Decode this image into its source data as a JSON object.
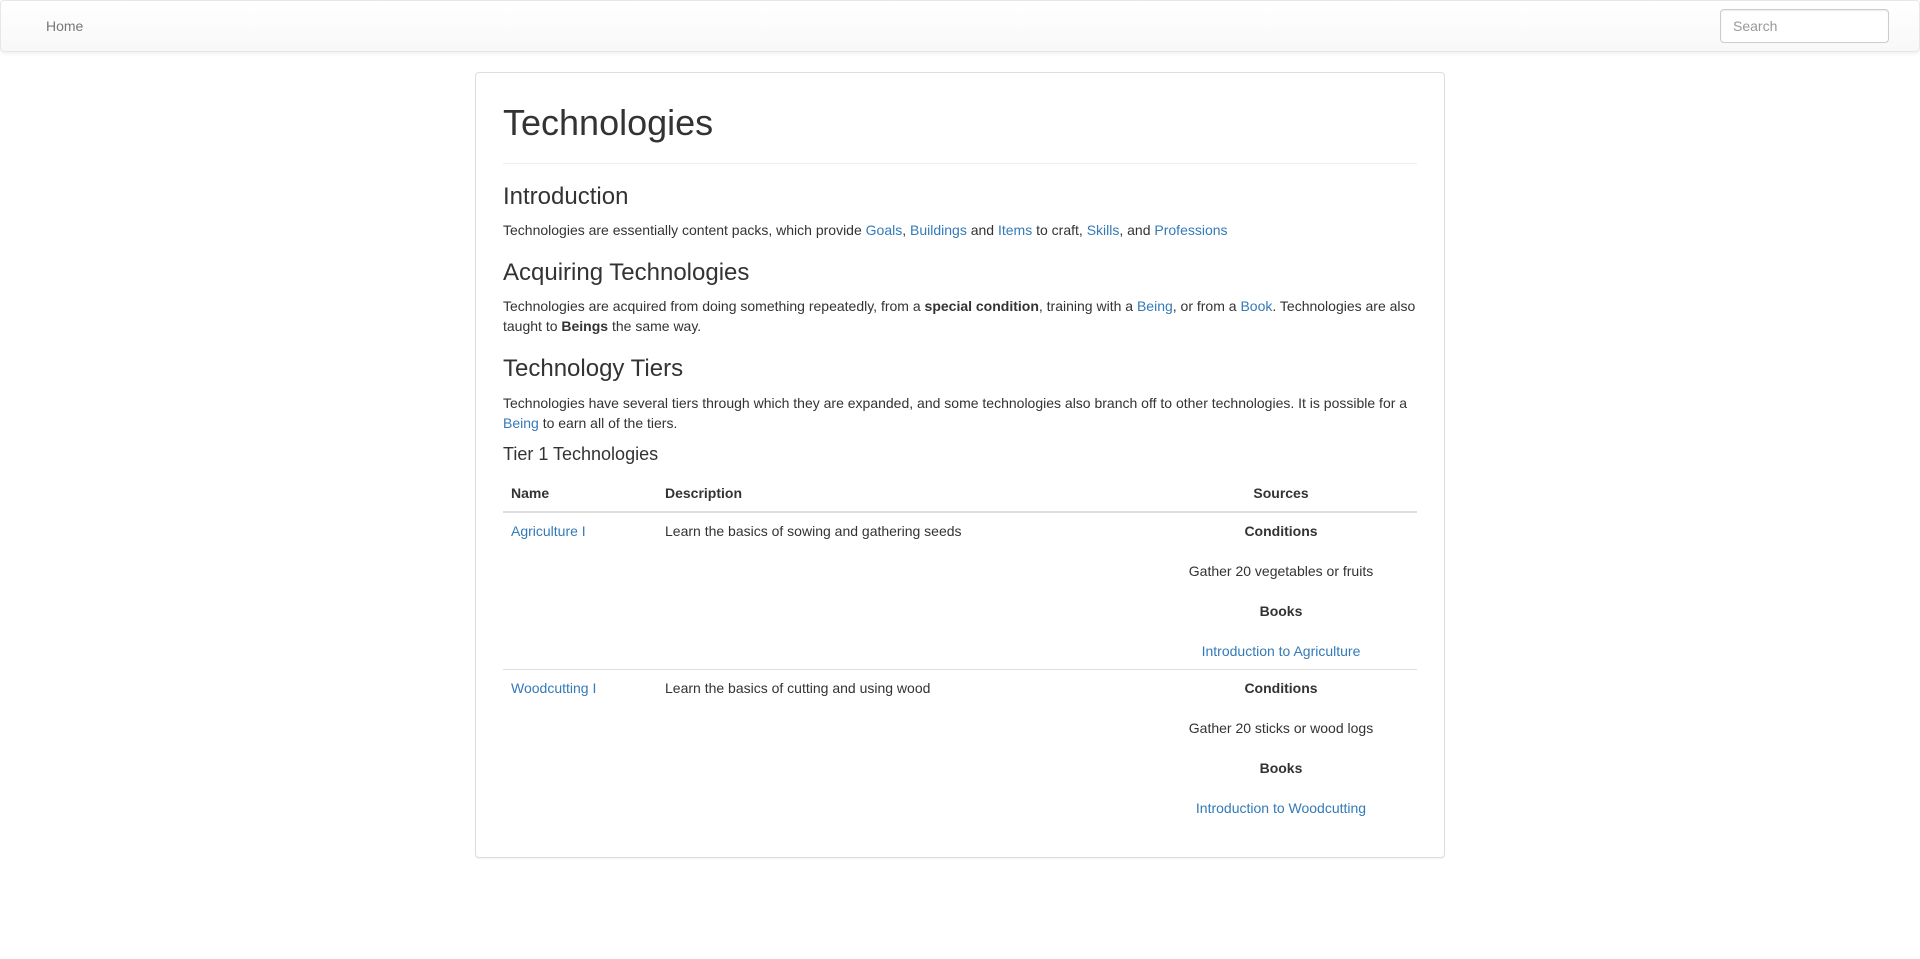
{
  "navbar": {
    "home_label": "Home",
    "search_placeholder": "Search"
  },
  "page": {
    "title": "Technologies",
    "intro": {
      "heading": "Introduction",
      "text_1": "Technologies are essentially content packs, which provide ",
      "link_goals": "Goals",
      "sep_1": ", ",
      "link_buildings": "Buildings",
      "text_2": " and ",
      "link_items": "Items",
      "text_3": " to craft, ",
      "link_skills": "Skills",
      "text_4": ", and ",
      "link_professions": "Professions"
    },
    "acquiring": {
      "heading": "Acquiring Technologies",
      "text_1": "Technologies are acquired from doing something repeatedly, from a ",
      "bold_1": "special condition",
      "text_2": ", training with a ",
      "link_being": "Being",
      "text_3": ", or from a ",
      "link_book": "Book",
      "text_4": ". Technologies are also taught to ",
      "bold_2": "Beings",
      "text_5": " the same way."
    },
    "tiers": {
      "heading": "Technology Tiers",
      "text_1": "Technologies have several tiers through which they are expanded, and some technologies also branch off to other technologies. It is possible for a ",
      "link_being": "Being",
      "text_2": " to earn all of the tiers."
    },
    "tier1": {
      "heading": "Tier 1 Technologies",
      "columns": [
        "Name",
        "Description",
        "Sources"
      ],
      "rows": [
        {
          "name": "Agriculture I",
          "description": "Learn the basics of sowing and gathering seeds",
          "conditions_label": "Conditions",
          "condition": "Gather 20 vegetables or fruits",
          "books_label": "Books",
          "book": "Introduction to Agriculture"
        },
        {
          "name": "Woodcutting I",
          "description": "Learn the basics of cutting and using wood",
          "conditions_label": "Conditions",
          "condition": "Gather 20 sticks or wood logs",
          "books_label": "Books",
          "book": "Introduction to Woodcutting"
        }
      ]
    }
  }
}
